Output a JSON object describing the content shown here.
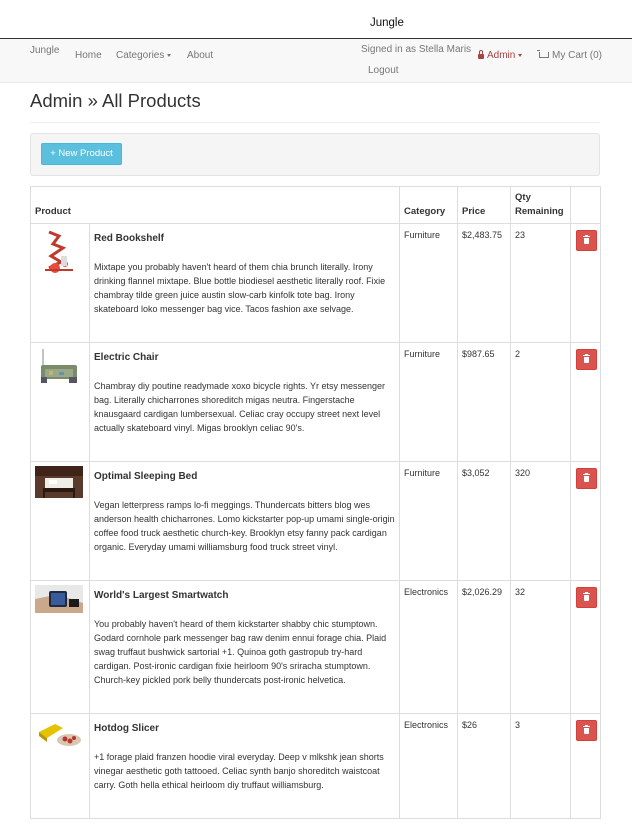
{
  "app": {
    "title": "Jungle"
  },
  "nav": {
    "brand": "Jungle",
    "home": "Home",
    "categories": "Categories",
    "about": "About",
    "signed_in": "Signed in as Stella Maris",
    "logout": "Logout",
    "admin": "Admin",
    "cart": "My Cart (0)",
    "icons": {
      "admin": "lock-icon",
      "cart": "shopping-cart-icon"
    }
  },
  "page": {
    "title": "Admin » All Products",
    "new_product": "+ New Product"
  },
  "table": {
    "headers": {
      "product": "Product",
      "category": "Category",
      "price": "Price",
      "qty": "Qty Remaining"
    },
    "rows": [
      {
        "name": "Red Bookshelf",
        "description": "Mixtape you probably haven't heard of them chia brunch literally. Irony drinking flannel mixtape. Blue bottle biodiesel aesthetic literally roof. Fixie chambray tilde green juice austin slow-carb kinfolk tote bag. Irony skateboard loko messenger bag vice. Tacos fashion axe selvage.",
        "category": "Furniture",
        "price": "$2,483.75",
        "qty": "23"
      },
      {
        "name": "Electric Chair",
        "description": "Chambray diy poutine readymade xoxo bicycle rights. Yr etsy messenger bag. Literally chicharrones shoreditch migas neutra. Fingerstache knausgaard cardigan lumbersexual. Celiac cray occupy street next level actually skateboard vinyl. Migas brooklyn celiac 90's.",
        "category": "Furniture",
        "price": "$987.65",
        "qty": "2"
      },
      {
        "name": "Optimal Sleeping Bed",
        "description": "Vegan letterpress ramps lo-fi meggings. Thundercats bitters blog wes anderson health chicharrones. Lomo kickstarter pop-up umami single-origin coffee food truck aesthetic church-key. Brooklyn etsy fanny pack cardigan organic. Everyday umami williamsburg food truck street vinyl.",
        "category": "Furniture",
        "price": "$3,052",
        "qty": "320"
      },
      {
        "name": "World's Largest Smartwatch",
        "description": "You probably haven't heard of them kickstarter shabby chic stumptown. Godard cornhole park messenger bag raw denim ennui forage chia. Plaid swag truffaut bushwick sartorial +1. Quinoa goth gastropub try-hard cardigan. Post-ironic cardigan fixie heirloom 90's sriracha stumptown. Church-key pickled pork belly thundercats post-ironic helvetica.",
        "category": "Electronics",
        "price": "$2,026.29",
        "qty": "32"
      },
      {
        "name": "Hotdog Slicer",
        "description": "+1 forage plaid franzen hoodie viral everyday. Deep v mlkshk jean shorts vinegar aesthetic goth tattooed. Celiac synth banjo shoreditch waistcoat carry. Goth hella ethical heirloom diy truffaut williamsburg.",
        "category": "Electronics",
        "price": "$26",
        "qty": "3"
      }
    ]
  },
  "colors": {
    "info": "#5bc0de",
    "danger": "#d9534f",
    "admin_link": "#a94442"
  }
}
